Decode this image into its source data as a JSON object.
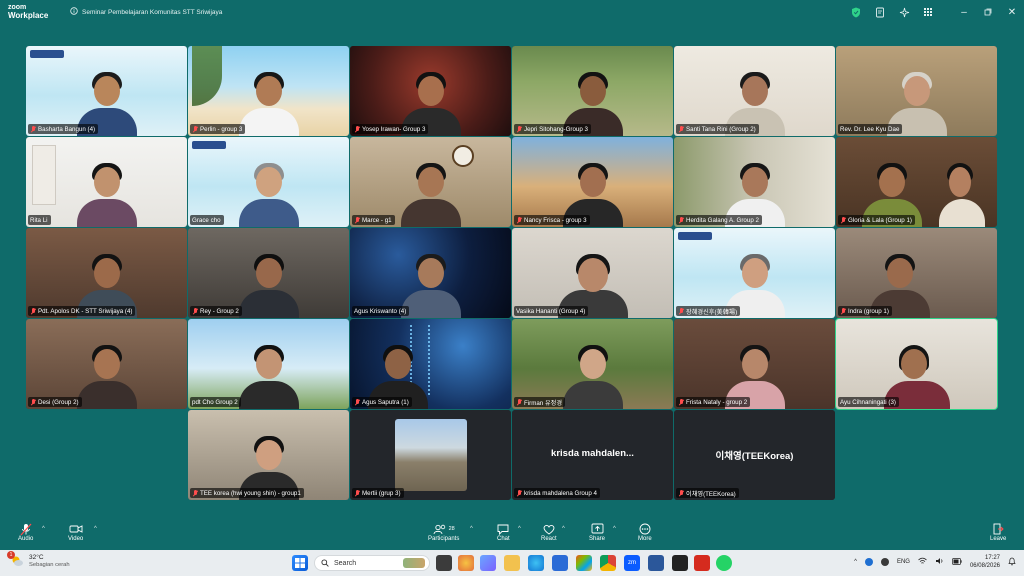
{
  "app": {
    "brand_line1": "zoom",
    "brand_line2": "Workplace",
    "meeting_title": "Seminar Pembelajaran Komunitas STT Sriwijaya"
  },
  "participants": [
    {
      "name": "Basharta Bangun (4)",
      "muted": true
    },
    {
      "name": "Perlin - group 3",
      "muted": true
    },
    {
      "name": "Yosep Irawan- Group 3",
      "muted": true
    },
    {
      "name": "Jepri Sitohang-Group 3",
      "muted": true
    },
    {
      "name": "Santi Tana Rini (Group 2)",
      "muted": true
    },
    {
      "name": "Rev.  Dr. Lee Kyu Dae",
      "muted": false
    },
    {
      "name": "Rita Li",
      "muted": false
    },
    {
      "name": "Grace cho",
      "muted": false
    },
    {
      "name": "Marce - g1",
      "muted": true
    },
    {
      "name": "Nancy Frisca - group 3",
      "muted": true
    },
    {
      "name": "Herdita Galang A. Group 2",
      "muted": true
    },
    {
      "name": "Gloria & Lala (Group 1)",
      "muted": true
    },
    {
      "name": "Pdt. Apolos DK - STT Sriwijaya (4)",
      "muted": true
    },
    {
      "name": "Rey - Group 2",
      "muted": true
    },
    {
      "name": "Agus Kriswanto (4)",
      "muted": false
    },
    {
      "name": "Vasika Hananti (Group 4)",
      "muted": false
    },
    {
      "name": "장혜경신후(美韓場)",
      "muted": true
    },
    {
      "name": "Indra (group 1)",
      "muted": true
    },
    {
      "name": "Desi (Group 2)",
      "muted": true
    },
    {
      "name": "pdt Cho Group 2",
      "muted": false
    },
    {
      "name": "Agus Saputra (1)",
      "muted": true
    },
    {
      "name": "Firman 유정경",
      "muted": true
    },
    {
      "name": "Frista Nataly - group 2",
      "muted": true
    },
    {
      "name": "Ayu Cihnaningati (3)",
      "muted": false
    },
    {
      "name": "TEE korea (hwi young shin) - group1",
      "muted": true
    },
    {
      "name": "Mertii (grup 3)",
      "muted": true
    },
    {
      "name": "krisda mahdalena Group 4",
      "muted": true,
      "display": "krisda  mahdalen..."
    },
    {
      "name": "이채영(TEEKorea)",
      "muted": true,
      "display": "이채영(TEEKorea)"
    }
  ],
  "toolbar": {
    "audio": "Audio",
    "video": "Video",
    "participants": "Participants",
    "participants_count": "28",
    "chat": "Chat",
    "react": "React",
    "share": "Share",
    "more": "More",
    "leave": "Leave"
  },
  "taskbar": {
    "temp": "32°C",
    "weather": "Sebagian cerah",
    "search_placeholder": "Search",
    "lang": "ENG",
    "time": "17:27",
    "date": "06/08/2026",
    "badge": "1"
  },
  "colors": {
    "zoom_teal": "#0f6b6a",
    "active_speaker": "#2fd38a",
    "muted_red": "#ff4d4d"
  }
}
